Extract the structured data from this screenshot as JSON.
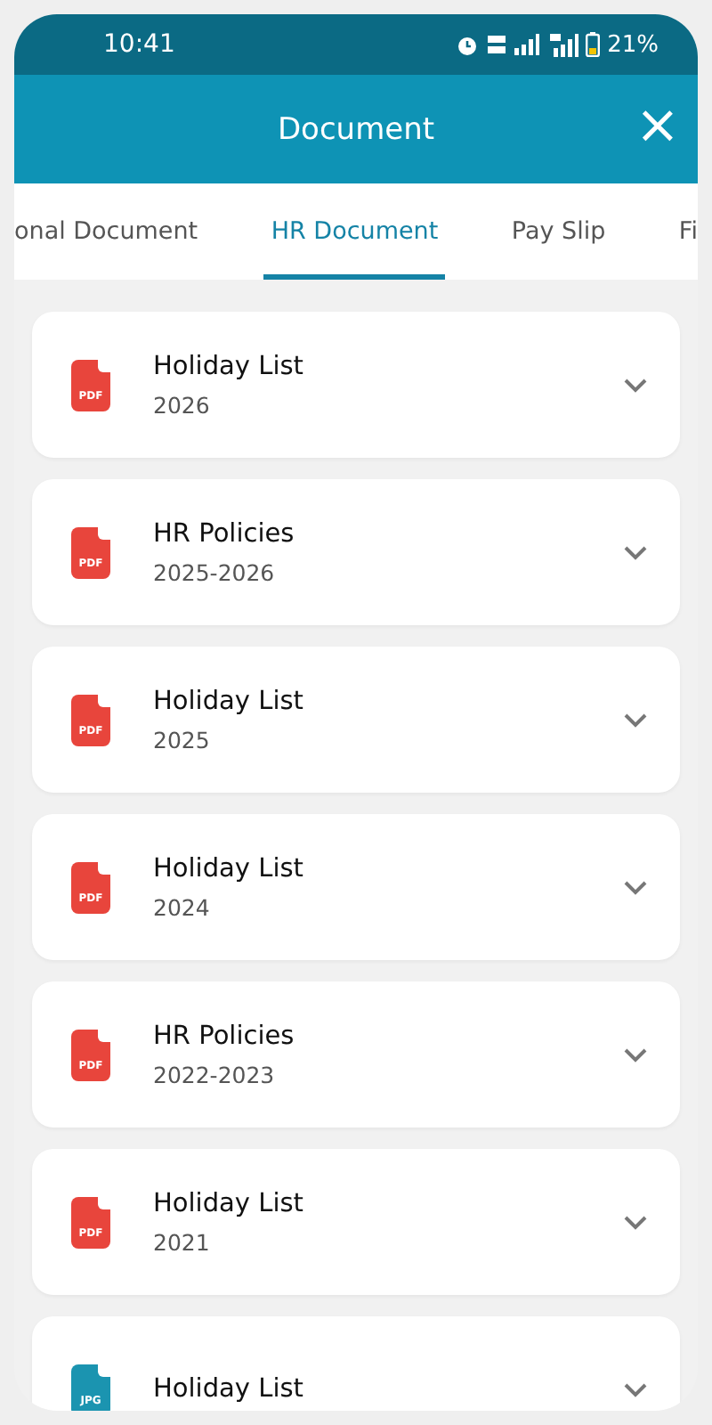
{
  "status_bar": {
    "time": "10:41",
    "battery": "21%"
  },
  "header": {
    "title": "Document",
    "close": "×"
  },
  "tabs": [
    {
      "label": "onal Document",
      "selected": false
    },
    {
      "label": "HR Document",
      "selected": true
    },
    {
      "label": "Pay Slip",
      "selected": false
    },
    {
      "label": "Fi",
      "selected": false
    }
  ],
  "documents": [
    {
      "title": "Holiday List",
      "subtitle": "2026",
      "kind": "pdf",
      "file_label": "PDF"
    },
    {
      "title": "HR Policies",
      "subtitle": "2025-2026",
      "kind": "pdf",
      "file_label": "PDF"
    },
    {
      "title": "Holiday List",
      "subtitle": "2025",
      "kind": "pdf",
      "file_label": "PDF"
    },
    {
      "title": "Holiday List",
      "subtitle": "2024",
      "kind": "pdf",
      "file_label": "PDF"
    },
    {
      "title": "HR Policies",
      "subtitle": "2022-2023",
      "kind": "pdf",
      "file_label": "PDF"
    },
    {
      "title": "Holiday List",
      "subtitle": "2021",
      "kind": "pdf",
      "file_label": "PDF"
    },
    {
      "title": "Holiday List",
      "kind": "jpg",
      "file_label": "JPG"
    }
  ]
}
